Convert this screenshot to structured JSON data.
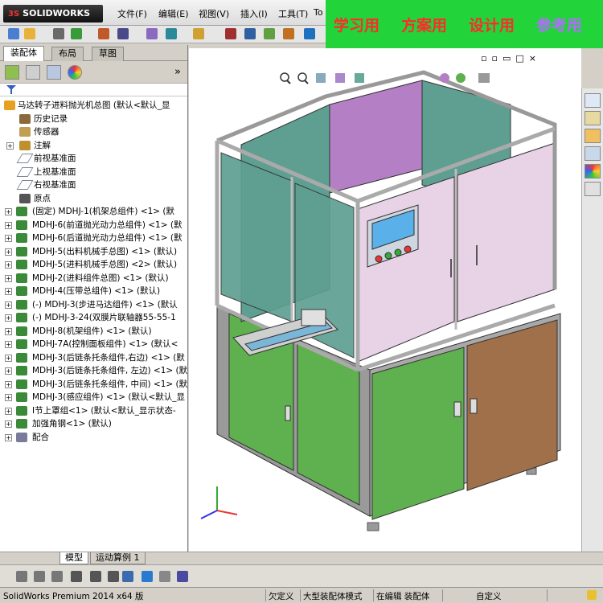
{
  "app": {
    "logo_text": "SOLIDWORKS",
    "logo_prefix": "3S"
  },
  "menu": [
    "文件(F)",
    "编辑(E)",
    "视图(V)",
    "插入(I)",
    "工具(T)",
    "To"
  ],
  "banner": {
    "items": [
      "学习用",
      "方案用",
      "设计用",
      "参考用"
    ],
    "colors": [
      "#ff2a2a",
      "#ff2a2a",
      "#ff2a2a",
      "#b36bff"
    ],
    "background": "#22d43a"
  },
  "panel": {
    "tabs": [
      "装配体",
      "布局",
      "草图"
    ],
    "filter_icon": "filter-icon",
    "expand_label": "»",
    "tree": [
      {
        "level": "top",
        "icon": "assembly-icon",
        "label": "马达转子进料抛光机总图  (默认<默认_显"
      },
      {
        "level": "sub",
        "icon": "history-icon",
        "label": "历史记录"
      },
      {
        "level": "sub",
        "icon": "sensor-icon",
        "label": "传感器"
      },
      {
        "level": "sub",
        "icon": "annotation-icon",
        "label": "注解",
        "expand": "+"
      },
      {
        "level": "sub",
        "icon": "plane-icon",
        "label": "前视基准面"
      },
      {
        "level": "sub",
        "icon": "plane-icon",
        "label": "上视基准面"
      },
      {
        "level": "sub",
        "icon": "plane-icon",
        "label": "右视基准面"
      },
      {
        "level": "sub",
        "icon": "origin-icon",
        "label": "原点"
      },
      {
        "level": "comp",
        "icon": "component-icon",
        "label": "(固定) MDHJ-1(机架总组件) <1> (默"
      },
      {
        "level": "comp",
        "icon": "component-icon",
        "label": "MDHJ-6(前道抛光动力总组件) <1> (默"
      },
      {
        "level": "comp",
        "icon": "component-icon",
        "label": "MDHJ-6(后道抛光动力总组件) <1> (默"
      },
      {
        "level": "comp",
        "icon": "component-icon",
        "label": "MDHJ-5(出料机械手总图) <1> (默认)"
      },
      {
        "level": "comp",
        "icon": "component-icon",
        "label": "MDHJ-5(进料机械手总图) <2> (默认)"
      },
      {
        "level": "comp",
        "icon": "component-icon",
        "label": "MDHJ-2(进料组件总图) <1> (默认)"
      },
      {
        "level": "comp",
        "icon": "component-icon",
        "label": "MDHJ-4(压带总组件) <1> (默认)"
      },
      {
        "level": "comp",
        "icon": "component-icon",
        "label": "(-) MDHJ-3(步进马达组件) <1> (默认"
      },
      {
        "level": "comp",
        "icon": "component-icon",
        "label": "(-) MDHJ-3-24(双膜片联轴器55-55-1"
      },
      {
        "level": "comp",
        "icon": "component-icon",
        "label": "MDHJ-8(机架组件) <1> (默认)"
      },
      {
        "level": "comp",
        "icon": "component-icon",
        "label": "MDHJ-7A(控制面板组件) <1> (默认<"
      },
      {
        "level": "comp",
        "icon": "component-icon",
        "label": "MDHJ-3(后链条托条组件,右边) <1> (默"
      },
      {
        "level": "comp",
        "icon": "component-icon",
        "label": "MDHJ-3(后链条托条组件, 左边) <1> (默"
      },
      {
        "level": "comp",
        "icon": "component-icon",
        "label": "MDHJ-3(后链条托条组件, 中间) <1> (默"
      },
      {
        "level": "comp",
        "icon": "component-icon",
        "label": "MDHJ-3(感应组件) <1> (默认<默认_显"
      },
      {
        "level": "comp",
        "icon": "component-icon",
        "label": "I节上罩组<1> (默认<默认_显示状态-"
      },
      {
        "level": "comp",
        "icon": "component-icon",
        "label": "加强角钢<1> (默认)"
      },
      {
        "level": "comp",
        "icon": "mates-icon",
        "label": "配合"
      }
    ]
  },
  "bottom_tabs": [
    "模型",
    "运动算例 1"
  ],
  "status": {
    "app_version": "SolidWorks Premium 2014 x64 版",
    "items": [
      "欠定义",
      "大型装配体模式",
      "在编辑 装配体",
      "自定义"
    ]
  },
  "colors": {
    "green_panel": "#5fb04f",
    "brown_panel": "#a0704a",
    "purple_glass": "#b57fc6",
    "teal_glass": "#5e9f92",
    "pink_glass": "#e8d2e6",
    "frame": "#c8c8c8"
  }
}
